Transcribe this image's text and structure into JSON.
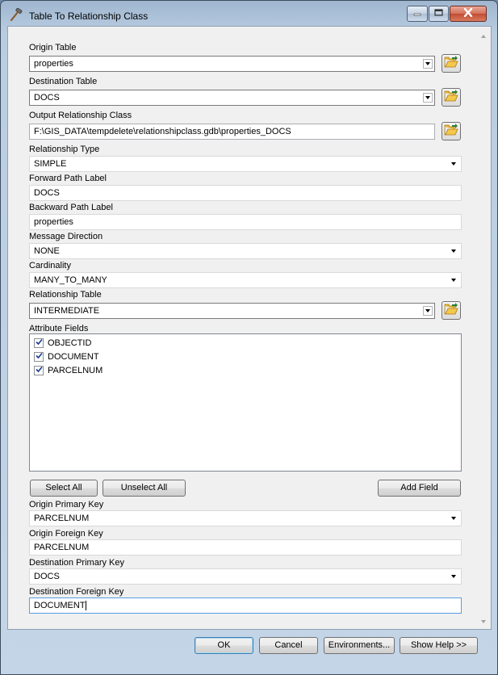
{
  "window": {
    "title": "Table To Relationship Class"
  },
  "icons": {
    "app": "hammer-icon",
    "minimize": "minimize-icon",
    "maximize": "maximize-icon",
    "close": "close-icon",
    "browse": "open-folder-icon"
  },
  "form": {
    "origin_table": {
      "label": "Origin Table",
      "value": "properties"
    },
    "destination_table": {
      "label": "Destination Table",
      "value": "DOCS"
    },
    "output_relationship_class": {
      "label": "Output Relationship Class",
      "value": "F:\\GIS_DATA\\tempdelete\\relationshipclass.gdb\\properties_DOCS"
    },
    "relationship_type": {
      "label": "Relationship Type",
      "value": "SIMPLE"
    },
    "forward_path_label": {
      "label": "Forward Path Label",
      "value": "DOCS"
    },
    "backward_path_label": {
      "label": "Backward Path Label",
      "value": "properties"
    },
    "message_direction": {
      "label": "Message Direction",
      "value": "NONE"
    },
    "cardinality": {
      "label": "Cardinality",
      "value": "MANY_TO_MANY"
    },
    "relationship_table": {
      "label": "Relationship Table",
      "value": "INTERMEDIATE"
    },
    "attribute_fields": {
      "label": "Attribute Fields",
      "items": [
        {
          "name": "OBJECTID",
          "checked": true
        },
        {
          "name": "DOCUMENT",
          "checked": true
        },
        {
          "name": "PARCELNUM",
          "checked": true
        }
      ]
    },
    "select_all_label": "Select All",
    "unselect_all_label": "Unselect All",
    "add_field_label": "Add Field",
    "origin_primary_key": {
      "label": "Origin Primary Key",
      "value": "PARCELNUM"
    },
    "origin_foreign_key": {
      "label": "Origin Foreign Key",
      "value": "PARCELNUM"
    },
    "destination_primary_key": {
      "label": "Destination Primary Key",
      "value": "DOCS"
    },
    "destination_foreign_key": {
      "label": "Destination Foreign Key",
      "value": "DOCUMENT"
    }
  },
  "buttons": {
    "ok": "OK",
    "cancel": "Cancel",
    "environments": "Environments...",
    "show_help": "Show Help >>"
  }
}
